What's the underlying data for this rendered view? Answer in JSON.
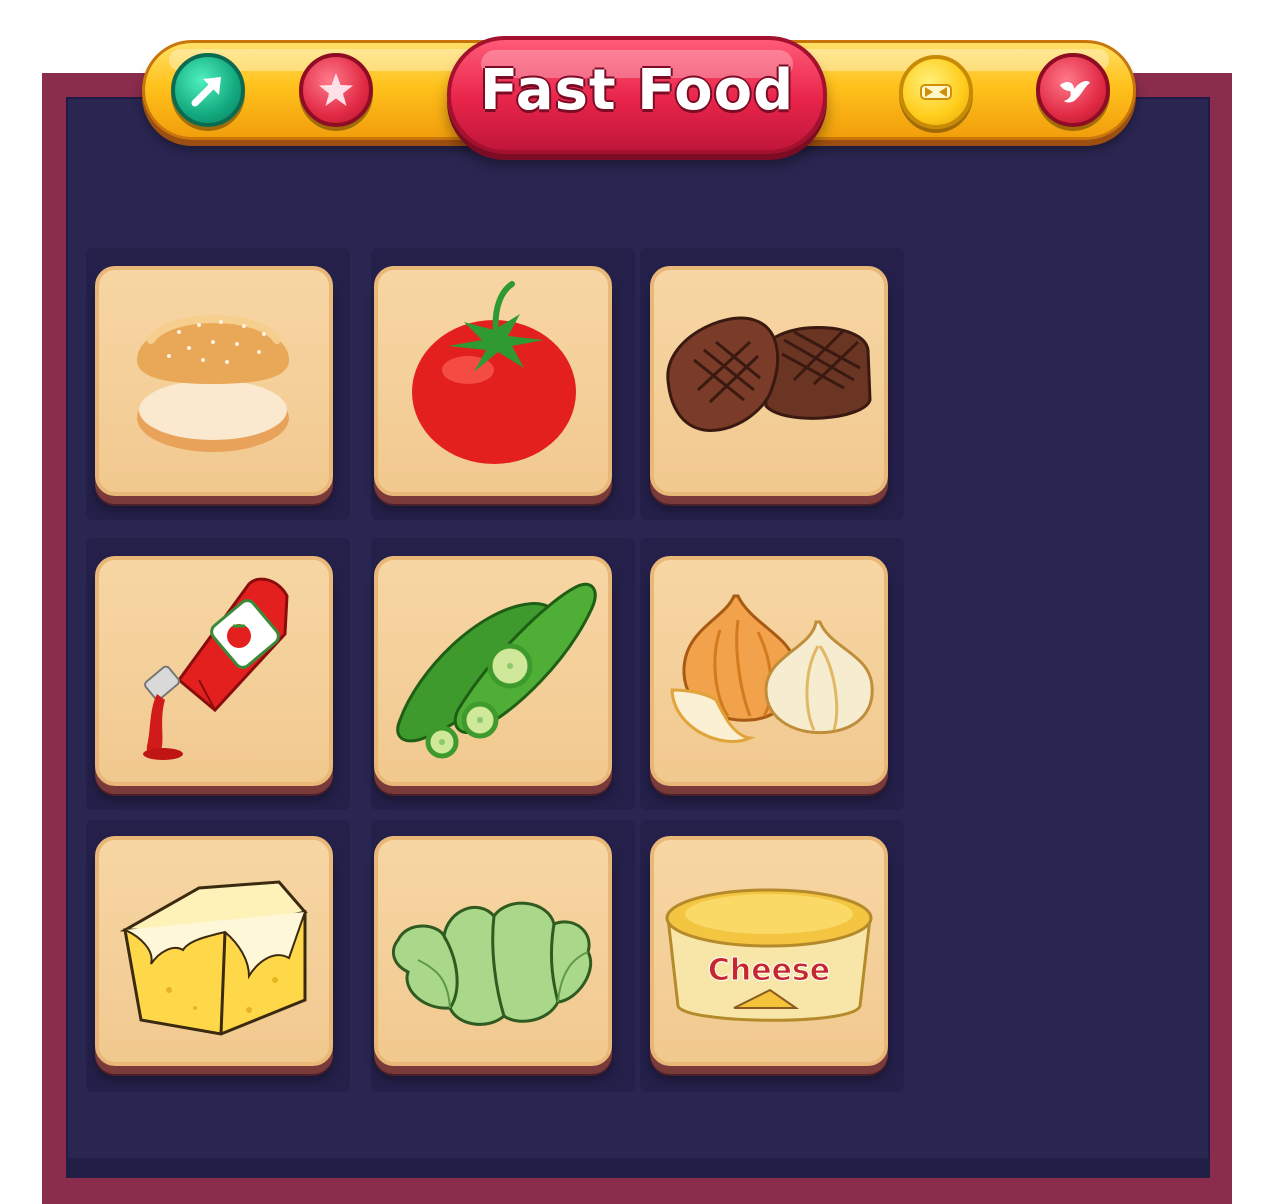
{
  "header": {
    "title": "Fast Food",
    "buttons": [
      {
        "icon": "arrow-icon",
        "color": "#13a97e"
      },
      {
        "icon": "star-icon",
        "color": "#e22b45"
      },
      {
        "icon": "skip-icon",
        "color": "#ffcc1a"
      },
      {
        "icon": "bird-icon",
        "color": "#e22b45"
      }
    ]
  },
  "grid": {
    "rows": 3,
    "cols": 3,
    "tiles": [
      {
        "item": "burger-bun-icon"
      },
      {
        "item": "tomato-icon"
      },
      {
        "item": "steak-icon"
      },
      {
        "item": "ketchup-icon"
      },
      {
        "item": "cucumber-icon"
      },
      {
        "item": "onion-icon"
      },
      {
        "item": "butter-icon"
      },
      {
        "item": "lettuce-icon"
      },
      {
        "item": "cheese-tub-icon",
        "label": "Cheese"
      }
    ]
  },
  "colors": {
    "board": "#2a2652",
    "frame": "#8a2c4c",
    "tile": "#f1c98f",
    "title_pill": "#e8244a",
    "top_bar": "#ffc21c"
  }
}
